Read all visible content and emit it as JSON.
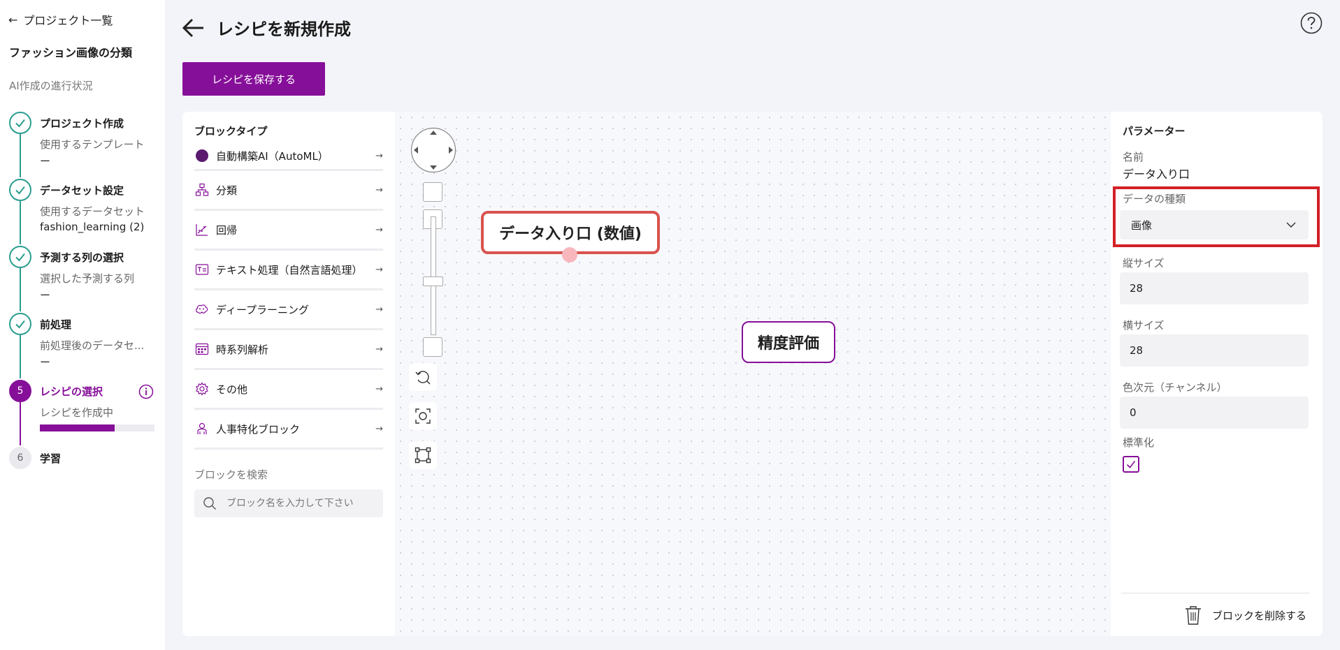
{
  "sidebar": {
    "back_label": "プロジェクト一覧",
    "project_name": "ファッション画像の分類",
    "progress_heading": "AI作成の進行状況",
    "steps": [
      {
        "number": "1",
        "title": "プロジェクト作成",
        "sub": "使用するテンプレート",
        "value": "ー",
        "status": "done"
      },
      {
        "number": "2",
        "title": "データセット設定",
        "sub": "使用するデータセット",
        "value": "fashion_learning (2)",
        "status": "done"
      },
      {
        "number": "3",
        "title": "予測する列の選択",
        "sub": "選択した予測する列",
        "value": "ー",
        "status": "done"
      },
      {
        "number": "4",
        "title": "前処理",
        "sub": "前処理後のデータセ...",
        "value": "ー",
        "status": "done"
      },
      {
        "number": "5",
        "title": "レシピの選択",
        "sub": "レシピを作成中",
        "progress": 0.65,
        "status": "active"
      },
      {
        "number": "6",
        "title": "学習",
        "status": "pending"
      }
    ]
  },
  "header": {
    "title": "レシピを新規作成",
    "save_label": "レシピを保存する"
  },
  "block_panel": {
    "heading": "ブロックタイプ",
    "items": [
      {
        "label": "自動構築AI（AutoML）",
        "icon": "automl-icon"
      },
      {
        "label": "分類",
        "icon": "classification-icon"
      },
      {
        "label": "回帰",
        "icon": "regression-icon"
      },
      {
        "label": "テキスト処理（自然言語処理）",
        "icon": "text-processing-icon"
      },
      {
        "label": "ディープラーニング",
        "icon": "deep-learning-icon"
      },
      {
        "label": "時系列解析",
        "icon": "time-series-icon"
      },
      {
        "label": "その他",
        "icon": "gear-icon"
      },
      {
        "label": "人事特化ブロック",
        "icon": "person-icon"
      }
    ],
    "search_label": "ブロックを検索",
    "search_placeholder": "ブロック名を入力して下さい"
  },
  "canvas": {
    "nodes": [
      {
        "label": "データ入り口 (数値)",
        "selected": true
      },
      {
        "label": "精度評価",
        "selected": false
      }
    ]
  },
  "params": {
    "heading": "パラメーター",
    "name_label": "名前",
    "name_value": "データ入り口",
    "data_type_label": "データの種類",
    "data_type_value": "画像",
    "height_label": "縦サイズ",
    "height_value": "28",
    "width_label": "横サイズ",
    "width_value": "28",
    "channel_label": "色次元（チャンネル）",
    "channel_value": "0",
    "normalize_label": "標準化",
    "normalize_checked": true,
    "delete_label": "ブロックを削除する"
  },
  "colors": {
    "accent": "#860f99",
    "done": "#2a9d8f",
    "highlight": "#d32027"
  }
}
